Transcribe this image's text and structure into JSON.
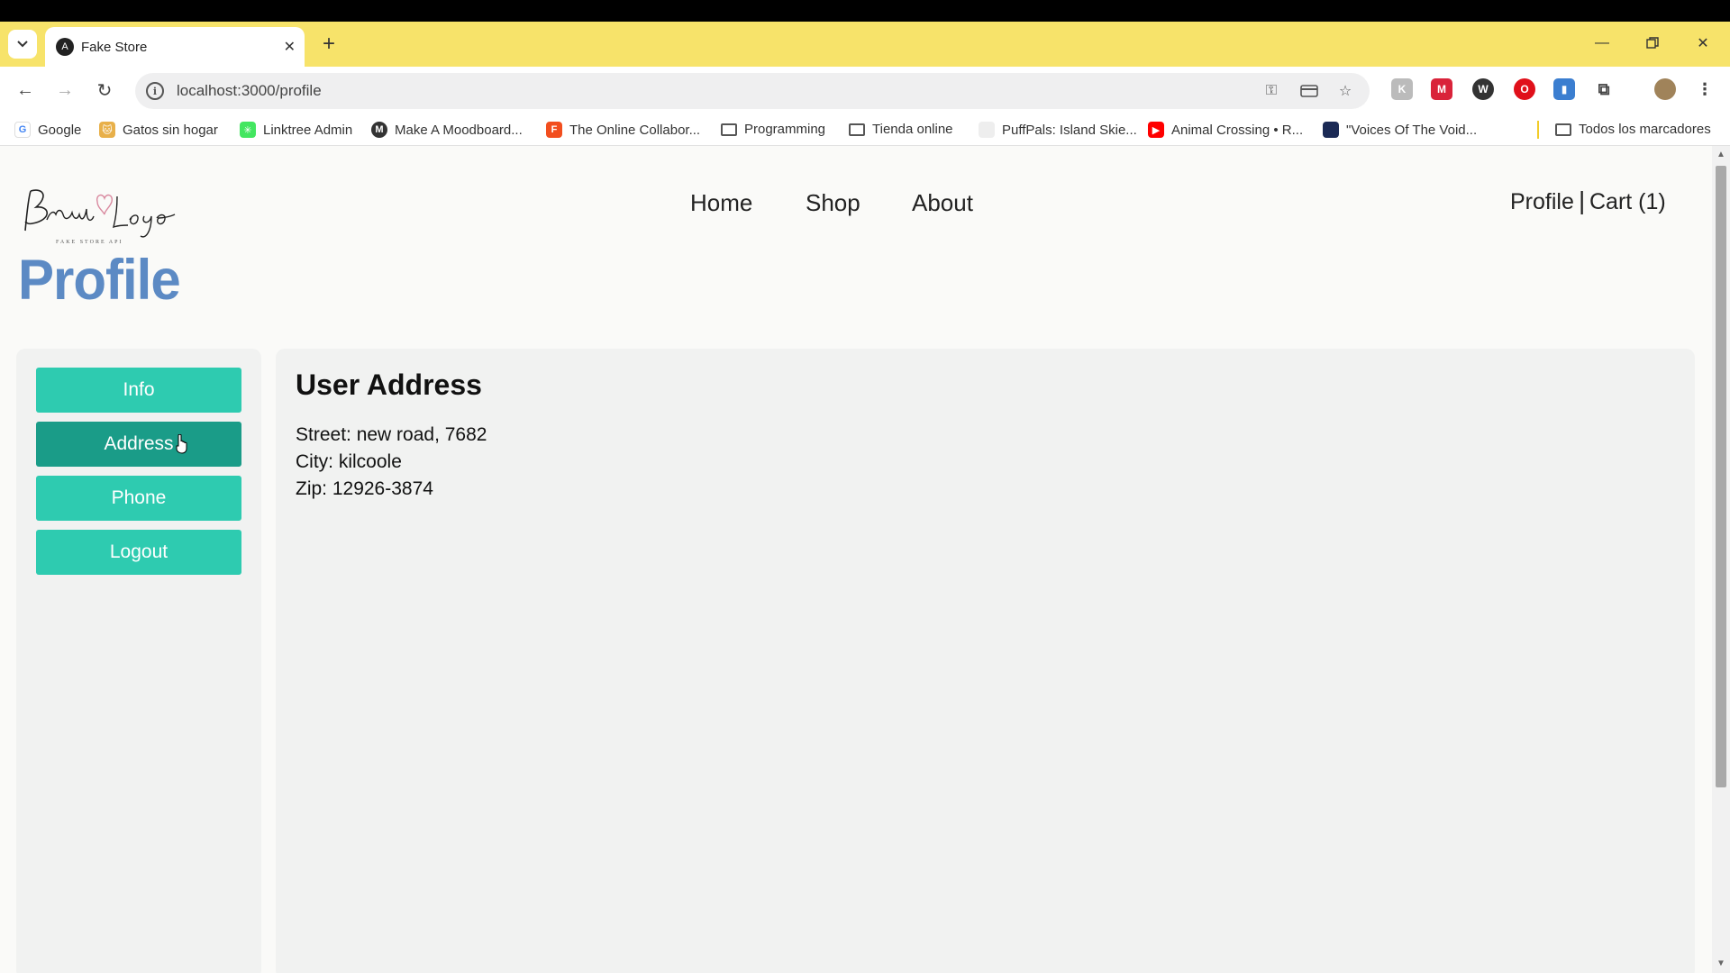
{
  "browser": {
    "tab": {
      "title": "Fake Store",
      "favicon": "A"
    },
    "address_bar": {
      "url": "localhost:3000/profile"
    },
    "bookmarks": [
      {
        "label": "Google",
        "icon": "google-icon"
      },
      {
        "label": "Gatos sin hogar",
        "icon": "gatos-icon"
      },
      {
        "label": "Linktree Admin",
        "icon": "linktree-icon"
      },
      {
        "label": "Make A Moodboard...",
        "icon": "moodboard-icon"
      },
      {
        "label": "The Online Collabor...",
        "icon": "figma-icon"
      },
      {
        "label": "Programming",
        "icon": "folder-icon"
      },
      {
        "label": "Tienda online",
        "icon": "folder-icon"
      },
      {
        "label": "PuffPals: Island Skie...",
        "icon": "puffpals-icon"
      },
      {
        "label": "Animal Crossing • R...",
        "icon": "youtube-icon"
      },
      {
        "label": "\"Voices Of The Void...",
        "icon": "voices-icon"
      }
    ],
    "all_bookmarks": "Todos los marcadores"
  },
  "site": {
    "logo_text": "Brand Logo",
    "logo_subtext": "FAKE STORE API",
    "nav": {
      "home": "Home",
      "shop": "Shop",
      "about": "About"
    },
    "user_nav": {
      "profile": "Profile",
      "separator": "|",
      "cart": "Cart (1)"
    }
  },
  "profile": {
    "title": "Profile",
    "menu": {
      "info": "Info",
      "address": "Address",
      "phone": "Phone",
      "logout": "Logout"
    },
    "active_section": "Address",
    "section": {
      "heading": "User Address",
      "street": "Street: new road, 7682",
      "city": "City: kilcoole",
      "zip": "Zip: 12926-3874"
    }
  },
  "colors": {
    "tab_strip": "#f7e36a",
    "button": "#2ecbb0",
    "button_active": "#1a9c88",
    "title": "#5c8ac4"
  }
}
